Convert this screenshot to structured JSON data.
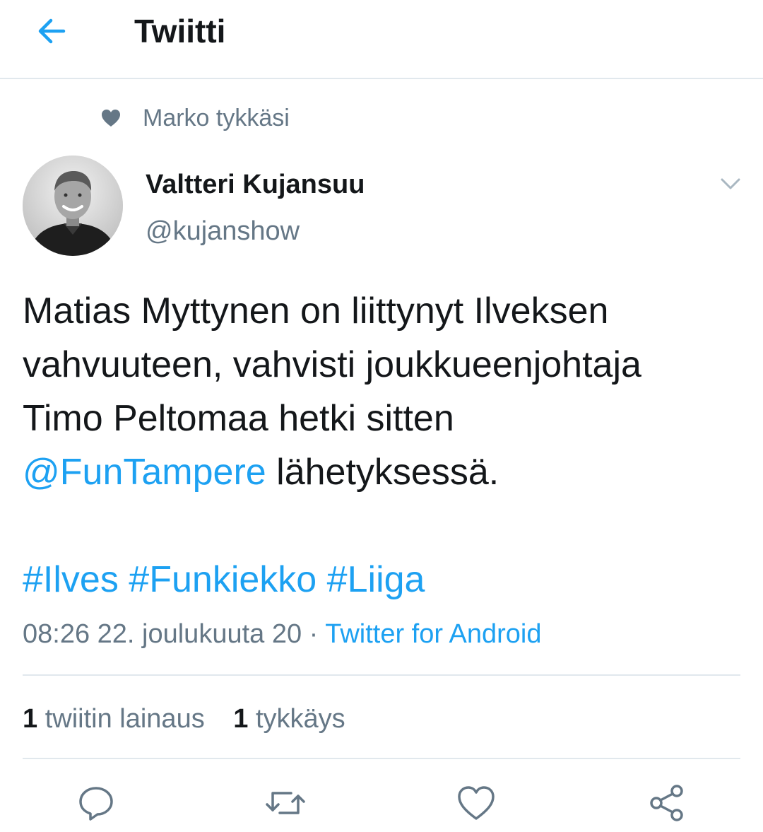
{
  "header": {
    "title": "Twiitti"
  },
  "social_context": {
    "text": "Marko tykkäsi"
  },
  "author": {
    "name": "Valtteri Kujansuu",
    "handle": "@kujanshow"
  },
  "tweet": {
    "line1": "Matias Myttynen on liittynyt Ilveksen",
    "line2": "vahvuuteen, vahvisti joukkueenjohtaja",
    "line3": "Timo Peltomaa hetki sitten",
    "mention": "@FunTampere",
    "line4_rest": " lähetyksessä.",
    "hashtags": [
      "#Ilves",
      "#Funkiekko",
      "#Liiga"
    ]
  },
  "meta": {
    "timestamp": "08:26 22. joulukuuta 20",
    "separator": " · ",
    "source": "Twitter for Android"
  },
  "stats": {
    "quotes_count": "1",
    "quotes_label": "twiitin lainaus",
    "likes_count": "1",
    "likes_label": "tykkäys"
  },
  "colors": {
    "accent": "#1da1f2",
    "secondary_text": "#657786",
    "primary_text": "#14171a",
    "divider": "#e1e8ed"
  },
  "icons": {
    "back": "arrow-left-icon",
    "social": "heart-icon",
    "caret": "chevron-down-icon",
    "reply": "reply-icon",
    "retweet": "retweet-icon",
    "like": "like-icon",
    "share": "share-icon"
  }
}
